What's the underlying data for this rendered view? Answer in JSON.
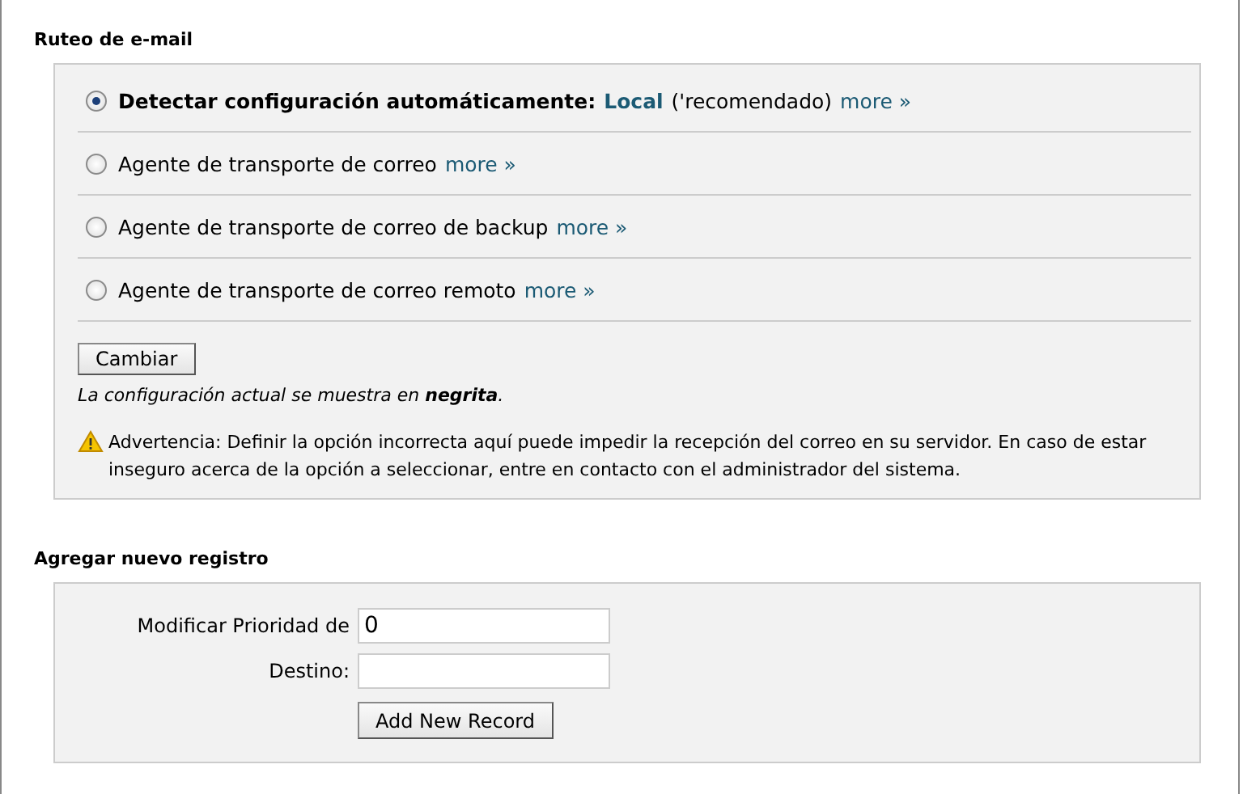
{
  "routing": {
    "heading": "Ruteo de e-mail",
    "options": [
      {
        "label": "Detectar configuración automáticamente:",
        "selected": true,
        "current": true,
        "value": "Local",
        "note": "('recomendado)",
        "more": "more »"
      },
      {
        "label": "Agente de transporte de correo",
        "selected": false,
        "current": false,
        "more": "more »"
      },
      {
        "label": "Agente de transporte de correo de backup",
        "selected": false,
        "current": false,
        "more": "more »"
      },
      {
        "label": "Agente de transporte de correo remoto",
        "selected": false,
        "current": false,
        "more": "more »"
      }
    ],
    "button": "Cambiar",
    "hint": "La configuración actual se muestra en **negrita**.",
    "warning": "Advertencia: Definir la opción incorrecta aquí puede impedir la recepción del correo en su servidor. En caso de estar inseguro acerca de la opción a seleccionar, entre en contacto con el administrador del sistema."
  },
  "add_record": {
    "heading": "Agregar nuevo registro",
    "fields": [
      {
        "label": "Modificar Prioridad de",
        "value": "0"
      },
      {
        "label": "Destino:"
      }
    ],
    "button": "Add New Record"
  }
}
